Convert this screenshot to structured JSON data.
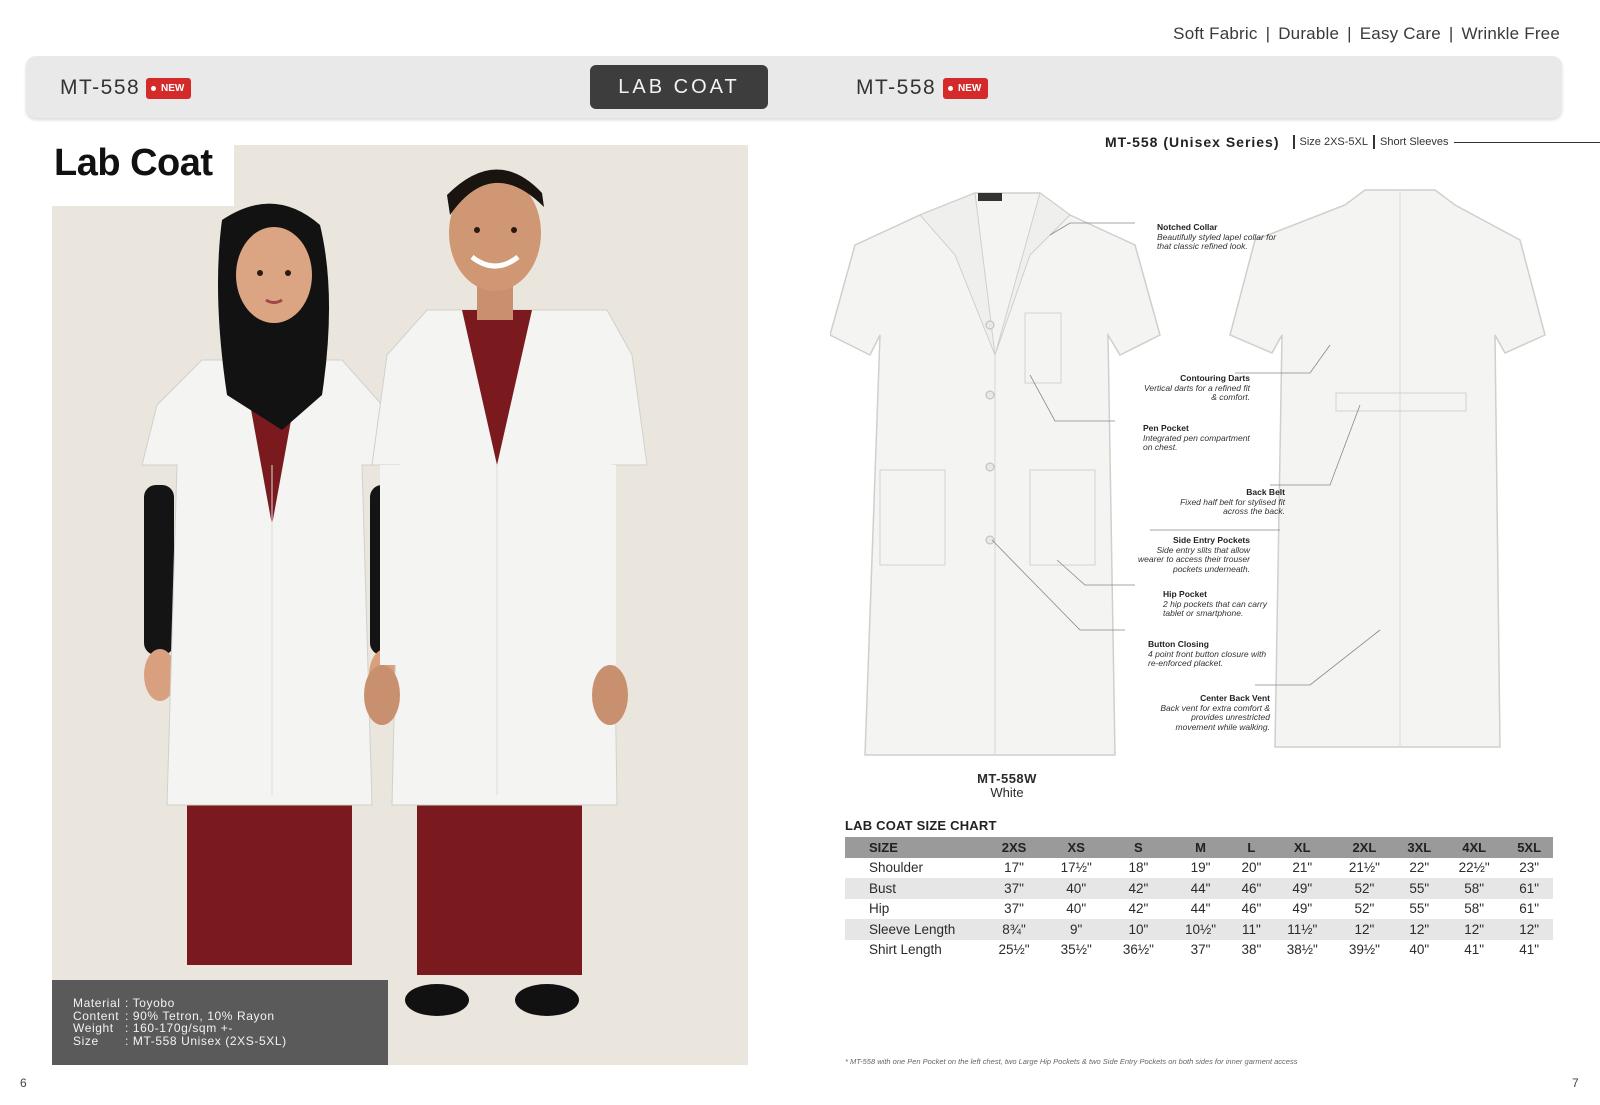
{
  "features": [
    "Soft Fabric",
    "Durable",
    "Easy Care",
    "Wrinkle Free"
  ],
  "features_separator": "|",
  "banner": {
    "left_code": "MT-558",
    "left_badge": "NEW",
    "center_label": "LAB COAT",
    "right_code": "MT-558",
    "right_badge": "NEW"
  },
  "left": {
    "title": "Lab Coat",
    "material": {
      "rows": [
        {
          "key": "Material",
          "value": ": Toyobo"
        },
        {
          "key": "Content",
          "value": ": 90% Tetron, 10% Rayon"
        },
        {
          "key": "Weight",
          "value": ": 160-170g/sqm +-"
        },
        {
          "key": "Size",
          "value": ": MT-558 Unisex (2XS-5XL)"
        }
      ]
    },
    "page_number": "6"
  },
  "right": {
    "series_title": "MT-558 (Unisex Series)",
    "series_size": "Size 2XS-5XL",
    "series_sleeve": "Short Sleeves",
    "model_code": "MT-558W",
    "model_color": "White",
    "callouts": [
      {
        "title": "Notched Collar",
        "text": "Beautifully styled lapel collar for that classic refined look."
      },
      {
        "title": "Contouring Darts",
        "text": "Vertical darts for a refined fit & comfort."
      },
      {
        "title": "Pen Pocket",
        "text": "Integrated pen compartment on chest."
      },
      {
        "title": "Back Belt",
        "text": "Fixed half belt for stylised fit across the back."
      },
      {
        "title": "Side Entry Pockets",
        "text": "Side entry slits that allow wearer to access their trouser pockets underneath."
      },
      {
        "title": "Hip Pocket",
        "text": "2 hip pockets that can carry tablet or smartphone."
      },
      {
        "title": "Button Closing",
        "text": "4 point front button closure with re-enforced placket."
      },
      {
        "title": "Center Back Vent",
        "text": "Back vent for extra comfort & provides unrestricted movement while walking."
      }
    ],
    "size_chart": {
      "title": "LAB COAT SIZE CHART",
      "headers": [
        "SIZE",
        "2XS",
        "XS",
        "S",
        "M",
        "L",
        "XL",
        "2XL",
        "3XL",
        "4XL",
        "5XL"
      ],
      "rows": [
        [
          "Shoulder",
          "17\"",
          "17½\"",
          "18\"",
          "19\"",
          "20\"",
          "21\"",
          "21½\"",
          "22\"",
          "22½\"",
          "23\""
        ],
        [
          "Bust",
          "37\"",
          "40\"",
          "42\"",
          "44\"",
          "46\"",
          "49\"",
          "52\"",
          "55\"",
          "58\"",
          "61\""
        ],
        [
          "Hip",
          "37\"",
          "40\"",
          "42\"",
          "44\"",
          "46\"",
          "49\"",
          "52\"",
          "55\"",
          "58\"",
          "61\""
        ],
        [
          "Sleeve Length",
          "8¾\"",
          "9\"",
          "10\"",
          "10½\"",
          "11\"",
          "11½\"",
          "12\"",
          "12\"",
          "12\"",
          "12\""
        ],
        [
          "Shirt Length",
          "25½\"",
          "35½\"",
          "36½\"",
          "37\"",
          "38\"",
          "38½\"",
          "39½\"",
          "40\"",
          "41\"",
          "41\""
        ]
      ]
    },
    "footnote": "* MT-558 with one Pen Pocket on the left chest, two Large Hip Pockets & two Side Entry Pockets on both sides for inner garment access",
    "page_number": "7"
  },
  "colors": {
    "badge_red": "#d42a2a",
    "coat_white": "#f4f4f2",
    "scrub_maroon": "#7a1a1e",
    "banner_gray": "#e9e9e9",
    "tab_dark": "#3d3d3d"
  }
}
